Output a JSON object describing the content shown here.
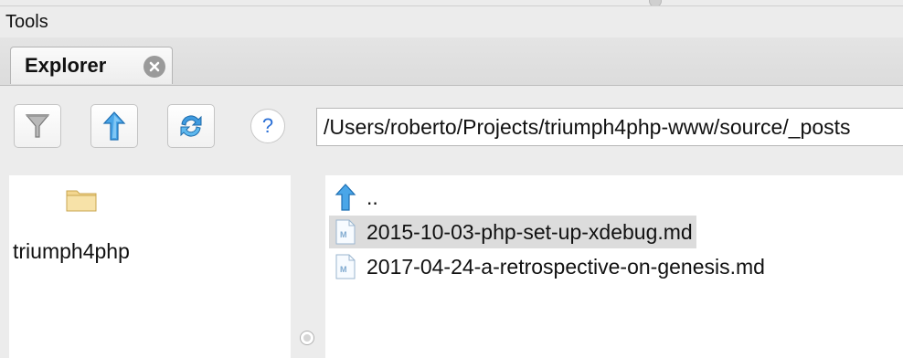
{
  "menubar": {
    "tools_label": "Tools"
  },
  "tab": {
    "label": "Explorer"
  },
  "toolbar": {
    "filter_icon": "filter-funnel-icon",
    "up_icon": "up-arrow-icon",
    "refresh_icon": "refresh-icon",
    "help_label": "?",
    "path_value": "/Users/roberto/Projects/triumph4php-www/source/_posts"
  },
  "tree": {
    "folder_label": "triumph4php"
  },
  "files": {
    "parent_label": "..",
    "items": [
      {
        "name": "2015-10-03-php-set-up-xdebug.md"
      },
      {
        "name": "2017-04-24-a-retrospective-on-genesis.md"
      }
    ]
  },
  "colors": {
    "accent_blue": "#2a6fd6",
    "selection": "#dcdcdc",
    "folder": "#f3d68f"
  }
}
